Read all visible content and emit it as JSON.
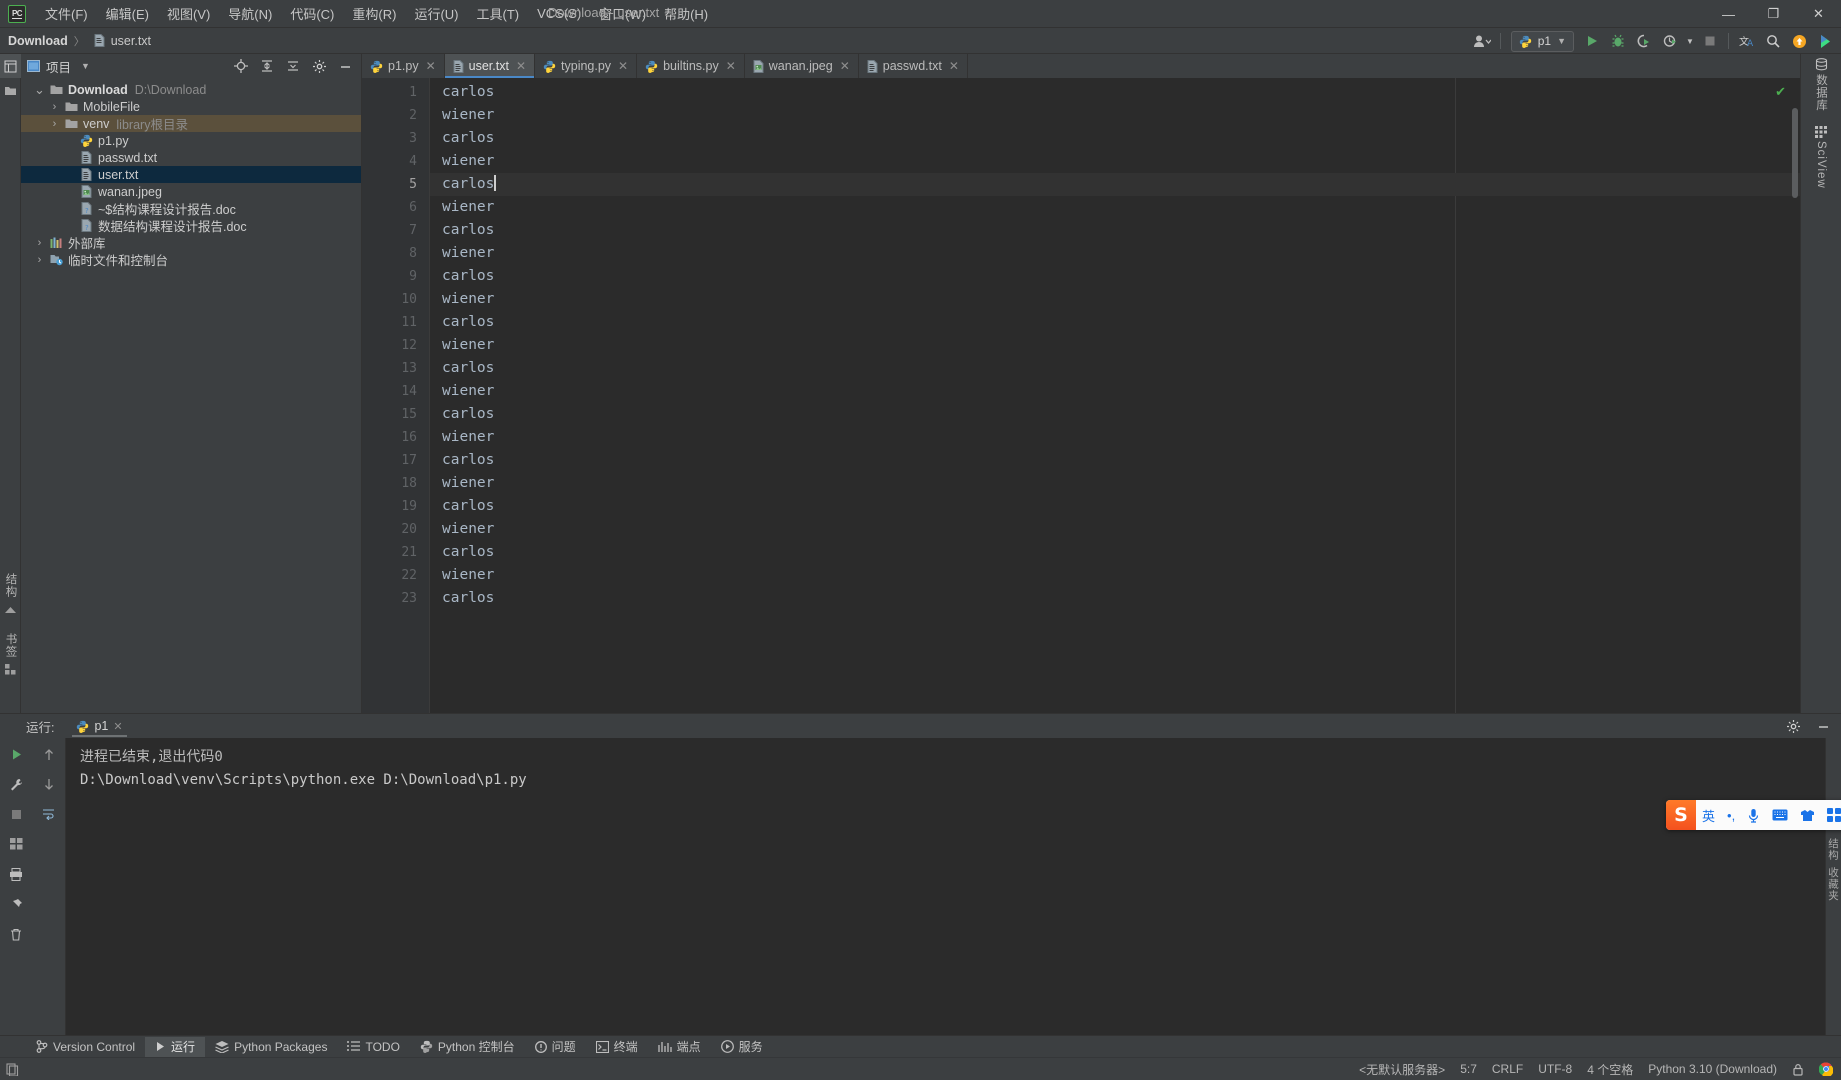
{
  "window": {
    "title": "Download - user.txt",
    "logo_text": "PC",
    "controls": {
      "minimize": "—",
      "maximize": "❐",
      "close": "✕"
    }
  },
  "menu": [
    {
      "label": "文件(F)"
    },
    {
      "label": "编辑(E)"
    },
    {
      "label": "视图(V)"
    },
    {
      "label": "导航(N)"
    },
    {
      "label": "代码(C)"
    },
    {
      "label": "重构(R)"
    },
    {
      "label": "运行(U)"
    },
    {
      "label": "工具(T)"
    },
    {
      "label": "VCS(S)"
    },
    {
      "label": "窗口(W)"
    },
    {
      "label": "帮助(H)"
    }
  ],
  "breadcrumb": {
    "project": "Download",
    "separator": "〉",
    "file": "user.txt"
  },
  "toolbar": {
    "account_icon": "user-account-icon",
    "run_config": "p1",
    "run": "run-icon",
    "debug": "debug-icon",
    "coverage": "coverage-icon",
    "profile": "profile-icon",
    "stop": "stop-icon",
    "translate": "translate-icon",
    "search": "search-icon",
    "update": "update-icon",
    "more": "more-icon"
  },
  "project_panel": {
    "title": "项目",
    "head_icons": [
      "locate-icon",
      "expand-all-icon",
      "collapse-all-icon",
      "settings-icon",
      "hide-icon"
    ],
    "tree": [
      {
        "label": "Download",
        "sub": "D:\\Download",
        "icon": "folder-icon",
        "arrow": "⌄",
        "depth": 0,
        "bold": true,
        "state": "normal"
      },
      {
        "label": "MobileFile",
        "sub": "",
        "icon": "folder-icon",
        "arrow": "›",
        "depth": 1,
        "bold": false,
        "state": "normal"
      },
      {
        "label": "venv",
        "sub": "library根目录",
        "icon": "folder-icon",
        "arrow": "›",
        "depth": 1,
        "bold": false,
        "state": "libroot"
      },
      {
        "label": "p1.py",
        "sub": "",
        "icon": "python-file-icon",
        "arrow": "",
        "depth": 2,
        "bold": false,
        "state": "normal"
      },
      {
        "label": "passwd.txt",
        "sub": "",
        "icon": "text-file-icon",
        "arrow": "",
        "depth": 2,
        "bold": false,
        "state": "normal"
      },
      {
        "label": "user.txt",
        "sub": "",
        "icon": "text-file-icon",
        "arrow": "",
        "depth": 2,
        "bold": false,
        "state": "selected"
      },
      {
        "label": "wanan.jpeg",
        "sub": "",
        "icon": "image-file-icon",
        "arrow": "",
        "depth": 2,
        "bold": false,
        "state": "normal"
      },
      {
        "label": "~$结构课程设计报告.doc",
        "sub": "",
        "icon": "unknown-file-icon",
        "arrow": "",
        "depth": 2,
        "bold": false,
        "state": "normal"
      },
      {
        "label": "数据结构课程设计报告.doc",
        "sub": "",
        "icon": "unknown-file-icon",
        "arrow": "",
        "depth": 2,
        "bold": false,
        "state": "normal"
      },
      {
        "label": "外部库",
        "sub": "",
        "icon": "library-icon",
        "arrow": "›",
        "depth": 0,
        "bold": false,
        "state": "normal"
      },
      {
        "label": "临时文件和控制台",
        "sub": "",
        "icon": "scratches-icon",
        "arrow": "›",
        "depth": 0,
        "bold": false,
        "state": "normal"
      }
    ]
  },
  "left_rail": {
    "top_icons": [
      "project-tool-icon",
      "structure-folder-icon"
    ],
    "bottom_labels": [
      "结构",
      "书签"
    ]
  },
  "right_rail": [
    {
      "label": "数据库",
      "icon": "database-icon"
    },
    {
      "label": "SciView",
      "icon": "sciview-icon"
    }
  ],
  "editor": {
    "tabs": [
      {
        "label": "p1.py",
        "icon": "python-file-icon",
        "active": false
      },
      {
        "label": "user.txt",
        "icon": "text-file-icon",
        "active": true
      },
      {
        "label": "typing.py",
        "icon": "python-file-icon",
        "active": false
      },
      {
        "label": "builtins.py",
        "icon": "python-file-icon",
        "active": false
      },
      {
        "label": "wanan.jpeg",
        "icon": "image-file-icon",
        "active": false
      },
      {
        "label": "passwd.txt",
        "icon": "text-file-icon",
        "active": false
      }
    ],
    "cursor_line": 5,
    "lines": [
      {
        "n": 1,
        "text": "carlos"
      },
      {
        "n": 2,
        "text": "wiener"
      },
      {
        "n": 3,
        "text": "carlos"
      },
      {
        "n": 4,
        "text": "wiener"
      },
      {
        "n": 5,
        "text": "carlos"
      },
      {
        "n": 6,
        "text": "wiener"
      },
      {
        "n": 7,
        "text": "carlos"
      },
      {
        "n": 8,
        "text": "wiener"
      },
      {
        "n": 9,
        "text": "carlos"
      },
      {
        "n": 10,
        "text": "wiener"
      },
      {
        "n": 11,
        "text": "carlos"
      },
      {
        "n": 12,
        "text": "wiener"
      },
      {
        "n": 13,
        "text": "carlos"
      },
      {
        "n": 14,
        "text": "wiener"
      },
      {
        "n": 15,
        "text": "carlos"
      },
      {
        "n": 16,
        "text": "wiener"
      },
      {
        "n": 17,
        "text": "carlos"
      },
      {
        "n": 18,
        "text": "wiener"
      },
      {
        "n": 19,
        "text": "carlos"
      },
      {
        "n": 20,
        "text": "wiener"
      },
      {
        "n": 21,
        "text": "carlos"
      },
      {
        "n": 22,
        "text": "wiener"
      },
      {
        "n": 23,
        "text": "carlos"
      }
    ],
    "inspection_status": "ok-check-icon"
  },
  "run_panel": {
    "label": "运行:",
    "tab": "p1",
    "tab_icon": "python-file-icon",
    "settings_icon": "settings-icon",
    "hide_icon": "hide-icon",
    "toolbar_icons": [
      "rerun-icon",
      "up-stack-icon",
      "wrench-icon",
      "down-stack-icon",
      "stop-icon",
      "soft-wrap-icon",
      "grid-icon",
      "print-icon",
      "pin-icon",
      "trash-icon"
    ],
    "console": [
      "D:\\Download\\venv\\Scripts\\python.exe D:\\Download\\p1.py",
      "",
      "进程已结束,退出代码0"
    ],
    "side_labels": [
      "结构",
      "收藏夹"
    ]
  },
  "status_tools": [
    {
      "label": "Version Control",
      "icon": "vcs-icon",
      "active": false
    },
    {
      "label": "运行",
      "icon": "run-icon",
      "active": true
    },
    {
      "label": "Python Packages",
      "icon": "packages-icon",
      "active": false
    },
    {
      "label": "TODO",
      "icon": "todo-icon",
      "active": false
    },
    {
      "label": "Python 控制台",
      "icon": "python-console-icon",
      "active": false
    },
    {
      "label": "问题",
      "icon": "problems-icon",
      "active": false
    },
    {
      "label": "终端",
      "icon": "terminal-icon",
      "active": false
    },
    {
      "label": "端点",
      "icon": "endpoints-icon",
      "active": false
    },
    {
      "label": "服务",
      "icon": "services-icon",
      "active": false
    }
  ],
  "status_bar": {
    "left_icon": "event-log-icon",
    "right": [
      "<无默认服务器>",
      "5:7",
      "CRLF",
      "UTF-8",
      "4 个空格",
      "Python 3.10 (Download)"
    ],
    "lock_icon": "lock-icon",
    "browser_icon": "chrome-icon"
  },
  "ime": {
    "logo": "S",
    "mode": "英",
    "punctuation": "•,",
    "buttons": [
      "mic-icon",
      "keyboard-icon",
      "skin-icon",
      "apps-icon"
    ]
  },
  "colors": {
    "accent": "#4a88c7",
    "selection": "#0d293e",
    "libroot": "#5b503c",
    "editor_bg": "#2b2b2b",
    "panel_bg": "#3c3f41",
    "green": "#4caf50"
  }
}
